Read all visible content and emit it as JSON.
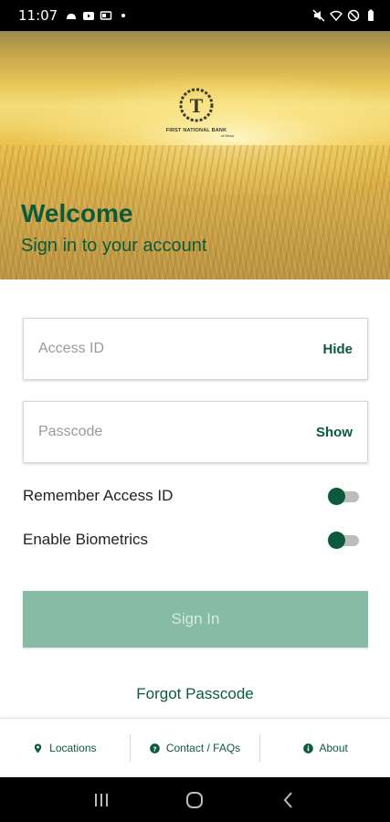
{
  "status_bar": {
    "time": "11:07",
    "left_icons": [
      "android-icon",
      "youtube-icon",
      "cast-icon",
      "dot-icon"
    ],
    "right_icons": [
      "mute-icon",
      "wifi-icon",
      "do-not-disturb-icon",
      "battery-icon"
    ]
  },
  "hero": {
    "logo_name": "FIRST NATIONAL BANK",
    "logo_sub": "of Mesa",
    "welcome": "Welcome",
    "subtitle": "Sign in to your account"
  },
  "form": {
    "access_id": {
      "placeholder": "Access ID",
      "value": "",
      "toggle_label": "Hide"
    },
    "passcode": {
      "placeholder": "Passcode",
      "value": "",
      "toggle_label": "Show"
    },
    "remember": {
      "label": "Remember Access ID",
      "on": true
    },
    "biometrics": {
      "label": "Enable Biometrics",
      "on": true
    },
    "sign_in_label": "Sign In",
    "forgot_label": "Forgot Passcode"
  },
  "footer": {
    "items": [
      {
        "label": "Locations",
        "icon": "location-pin-icon"
      },
      {
        "label": "Contact / FAQs",
        "icon": "help-icon"
      },
      {
        "label": "About",
        "icon": "info-icon"
      }
    ]
  },
  "colors": {
    "brand_green": "#0b5a3a",
    "button_disabled": "#86bba6"
  }
}
